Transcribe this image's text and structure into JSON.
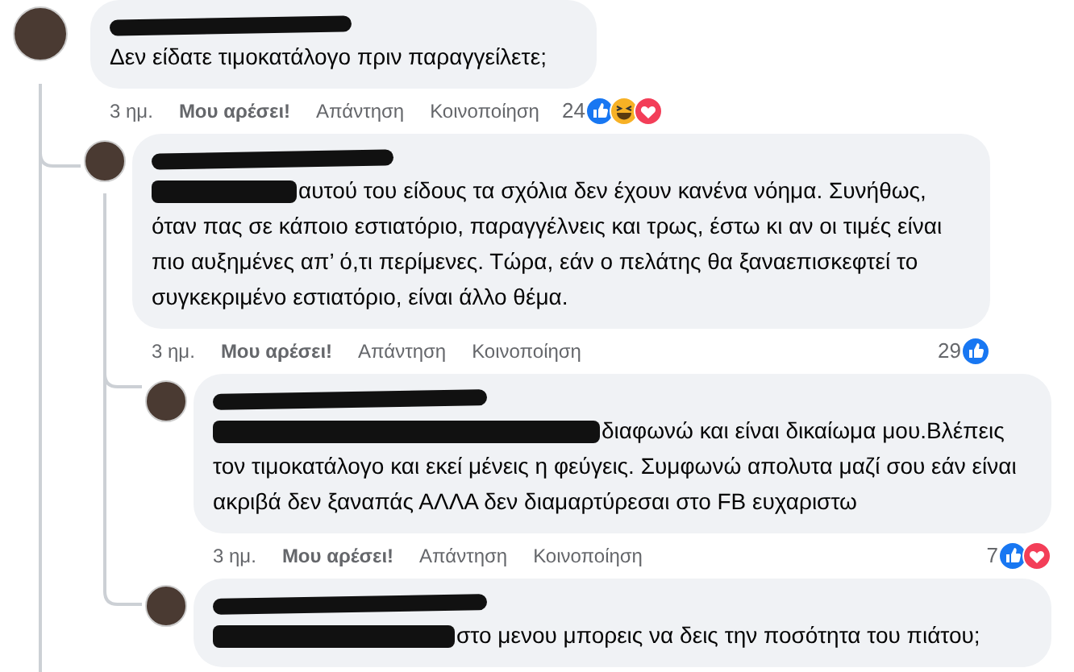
{
  "comments": [
    {
      "text": "Δεν είδατε τιμοκατάλογο πριν παραγγείλετε;",
      "mention": false,
      "time": "3 ημ.",
      "like": "Μου αρέσει!",
      "reply": "Απάντηση",
      "share": "Κοινοποίηση",
      "reaction_count": "24",
      "reactions": [
        {
          "kind": "like"
        },
        {
          "kind": "haha"
        },
        {
          "kind": "love"
        }
      ],
      "children": [
        {
          "text": "αυτού του είδους τα σχόλια δεν έχουν κανένα νόημα. Συνήθως, όταν πας σε κάποιο εστιατόριο, παραγγέλνεις και τρως, έστω κι αν οι τιμές είναι πιο αυξημένες απ’ ό,τι περίμενες. Τώρα, εάν ο πελάτης θα ξαναεπισκεφτεί το συγκεκριμένο εστιατόριο, είναι άλλο θέμα.",
          "mention": true,
          "time": "3 ημ.",
          "like": "Μου αρέσει!",
          "reply": "Απάντηση",
          "share": "Κοινοποίηση",
          "reaction_count": "29",
          "reactions": [
            {
              "kind": "like"
            }
          ],
          "children": [
            {
              "text": "διαφωνώ και είναι δικαίωμα μου.Βλέπεις τον τιμοκατάλογο και εκεί μένεις η φεύγεις. Συμφωνώ απολυτα μαζί σου εάν είναι ακριβά δεν ξαναπάς ΑΛΛΑ δεν διαμαρτύρεσαι στο FB ευχαριστω",
              "mention": true,
              "time": "3 ημ.",
              "like": "Μου αρέσει!",
              "reply": "Απάντηση",
              "share": "Κοινοποίηση",
              "reaction_count": "7",
              "reactions": [
                {
                  "kind": "like"
                },
                {
                  "kind": "love"
                }
              ]
            },
            {
              "text": "στο μενου μπορεις να δεις την ποσότητα του πιάτου;",
              "mention": true
            }
          ]
        }
      ]
    }
  ]
}
